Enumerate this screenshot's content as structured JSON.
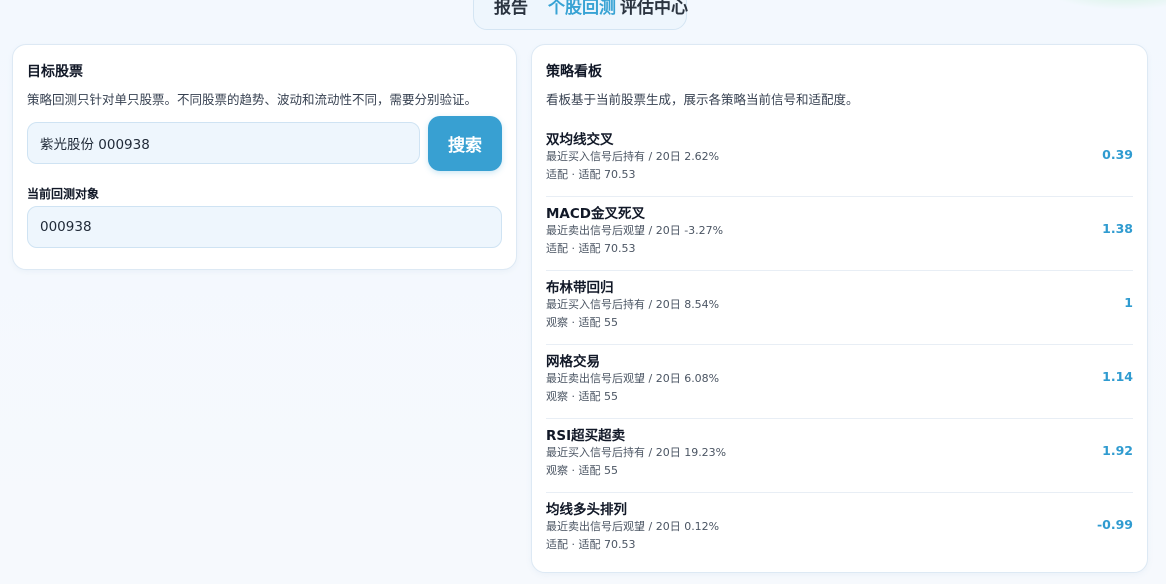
{
  "tabs": [
    {
      "label": "报告"
    },
    {
      "label": "个股回测"
    },
    {
      "label": "评估中心"
    }
  ],
  "target_panel": {
    "title": "目标股票",
    "description": "策略回测只针对单只股票。不同股票的趋势、波动和流动性不同，需要分别验证。",
    "search_value": "紫光股份 000938",
    "search_button": "搜索",
    "current_label": "当前回测对象",
    "current_value": "000938"
  },
  "board": {
    "title": "策略看板",
    "description": "看板基于当前股票生成，展示各策略当前信号和适配度。",
    "strategies": [
      {
        "name": "双均线交叉",
        "signal": "最近买入信号后持有 / 20日 2.62%",
        "fit": "适配 · 适配 70.53",
        "score": "0.39"
      },
      {
        "name": "MACD金叉死叉",
        "signal": "最近卖出信号后观望 / 20日 -3.27%",
        "fit": "适配 · 适配 70.53",
        "score": "1.38"
      },
      {
        "name": "布林带回归",
        "signal": "最近买入信号后持有 / 20日 8.54%",
        "fit": "观察 · 适配 55",
        "score": "1"
      },
      {
        "name": "网格交易",
        "signal": "最近卖出信号后观望 / 20日 6.08%",
        "fit": "观察 · 适配 55",
        "score": "1.14"
      },
      {
        "name": "RSI超买超卖",
        "signal": "最近买入信号后持有 / 20日 19.23%",
        "fit": "观察 · 适配 55",
        "score": "1.92"
      },
      {
        "name": "均线多头排列",
        "signal": "最近卖出信号后观望 / 20日 0.12%",
        "fit": "适配 · 适配 70.53",
        "score": "-0.99"
      }
    ]
  },
  "colors": {
    "accent": "#38a0d2",
    "score": "#2f9bd0",
    "input_bg": "#eef6fd"
  }
}
